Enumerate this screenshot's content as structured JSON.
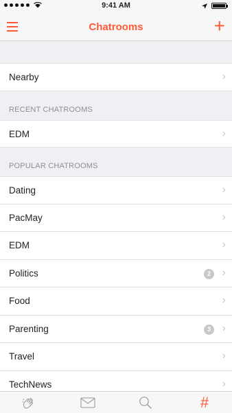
{
  "status_bar": {
    "time": "9:41 AM"
  },
  "nav": {
    "title": "Chatrooms",
    "accent": "#ff5a36"
  },
  "nearby": {
    "label": "Nearby"
  },
  "recent": {
    "header": "RECENT CHATROOMS",
    "items": [
      {
        "label": "EDM"
      }
    ]
  },
  "popular": {
    "header": "POPULAR CHATROOMS",
    "items": [
      {
        "label": "Dating"
      },
      {
        "label": "PacMay"
      },
      {
        "label": "EDM"
      },
      {
        "label": "Politics",
        "badge": "2"
      },
      {
        "label": "Food"
      },
      {
        "label": "Parenting",
        "badge": "3"
      },
      {
        "label": "Travel"
      },
      {
        "label": "TechNews"
      }
    ]
  },
  "tab_bar": {
    "tabs": [
      {
        "icon": "hand-wave-icon",
        "active": false
      },
      {
        "icon": "envelope-icon",
        "active": false
      },
      {
        "icon": "search-icon",
        "active": false
      },
      {
        "icon": "hashtag-icon",
        "active": true,
        "glyph": "#"
      }
    ]
  }
}
